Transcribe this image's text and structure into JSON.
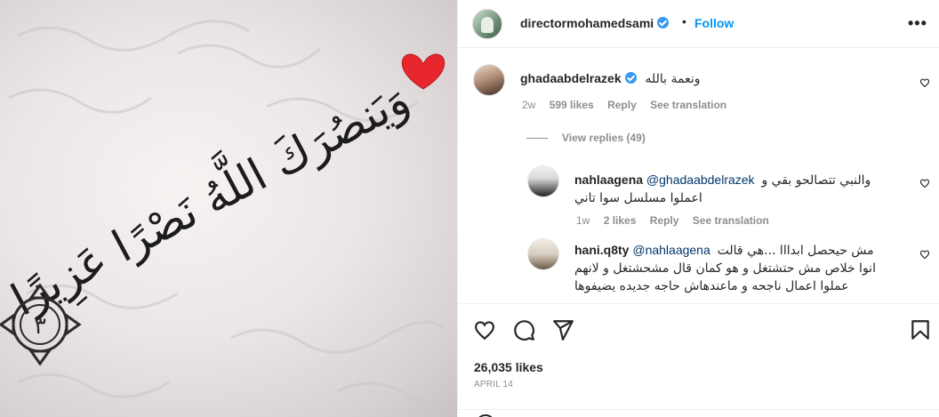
{
  "header": {
    "username": "directormohamedsami",
    "dot": "•",
    "follow_label": "Follow",
    "more_label": "•••"
  },
  "image": {
    "arabic_text": "وَيَنصُرَكَ اللَّهُ نَصْرًا عَزِيزًا",
    "verse_number": "٣",
    "heart_color": "#e8262e"
  },
  "comments": [
    {
      "username": "ghadaabdelrazek",
      "verified": true,
      "text": "ونعمة بالله",
      "time": "2w",
      "likes": "599 likes",
      "reply_label": "Reply",
      "translation_label": "See translation",
      "view_replies": "View replies (49)"
    },
    {
      "username": "nahlaagena",
      "mention": "@ghadaabdelrazek",
      "text_line1": "والنبي تتصالحو بقي و",
      "text_line2": "اعملوا مسلسل سوا تاني",
      "time": "1w",
      "likes": "2 likes",
      "reply_label": "Reply",
      "translation_label": "See translation"
    },
    {
      "username": "hani.q8ty",
      "mention": "@nahlaagena",
      "text_line1": "مش حيحصل ابدااا ...هي قالت",
      "text_line2": "انوا خلاص مش حتشتغل و هو كمان قال مشحشتغل و لانهم",
      "text_line3": "عملوا اعمال ناجحه و ماعندهاش حاجه جديده يضيفوها"
    }
  ],
  "actions": {
    "likes": "26,035 likes",
    "date": "APRIL 14"
  },
  "icons": [
    "heart-icon",
    "comment-icon",
    "share-icon",
    "bookmark-icon",
    "more-icon",
    "verified-icon"
  ],
  "colors": {
    "accent": "#0095f6",
    "verified": "#3897f0",
    "muted": "#8e8e8e",
    "mention": "#00376b"
  }
}
